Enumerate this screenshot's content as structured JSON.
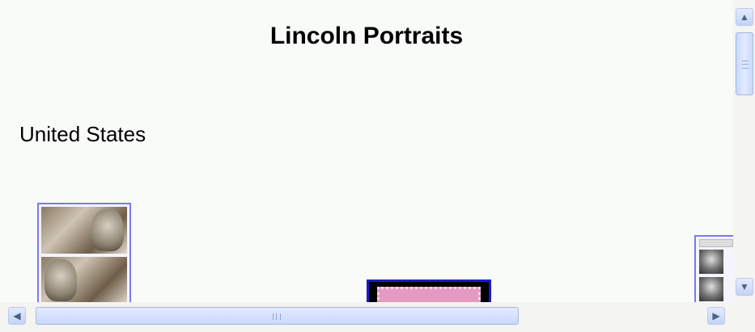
{
  "page": {
    "title": "Lincoln Portraits",
    "section_heading": "United States"
  },
  "stamps": [
    {
      "name": "lincoln-stamp-block"
    },
    {
      "name": "pink-framed-stamp"
    },
    {
      "name": "lincoln-photo-sheet"
    }
  ],
  "scrollbars": {
    "vertical": {
      "up_icon": "triangle-up-icon",
      "down_icon": "triangle-down-icon",
      "up_glyph": "▲",
      "down_glyph": "▼"
    },
    "horizontal": {
      "left_icon": "triangle-left-icon",
      "right_icon": "triangle-right-icon",
      "left_glyph": "◀",
      "right_glyph": "▶"
    }
  }
}
